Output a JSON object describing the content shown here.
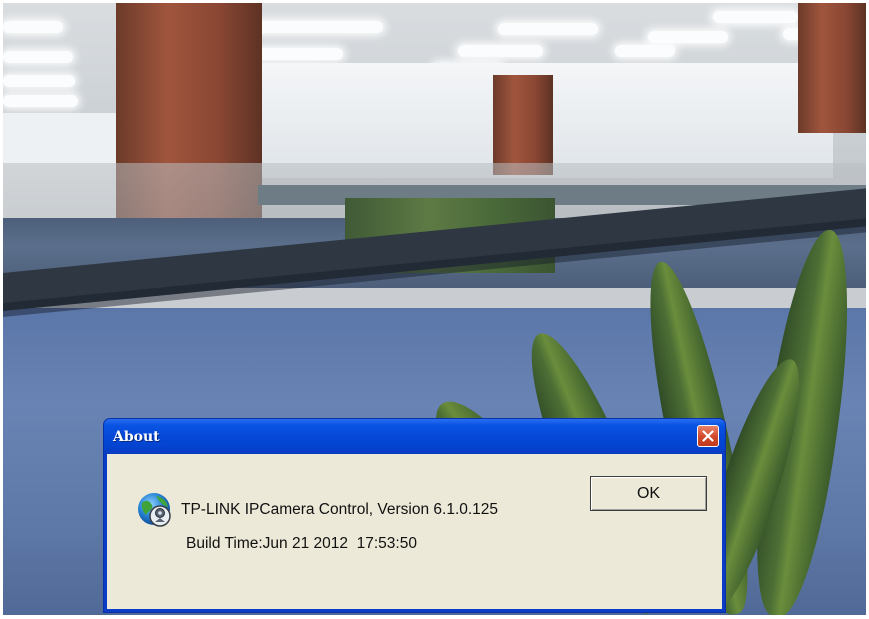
{
  "dialog": {
    "title": "About",
    "product_line": "TP-LINK IPCamera Control, Version 6.1.0.125",
    "build_line": "Build Time:Jun 21 2012  17:53:50",
    "ok_label": "OK",
    "close_icon": "close-icon",
    "app_icon": "globe-camera-icon"
  },
  "colors": {
    "title_bar": "#0548d8",
    "dialog_body": "#ece9d8",
    "close_button": "#d2482a"
  }
}
